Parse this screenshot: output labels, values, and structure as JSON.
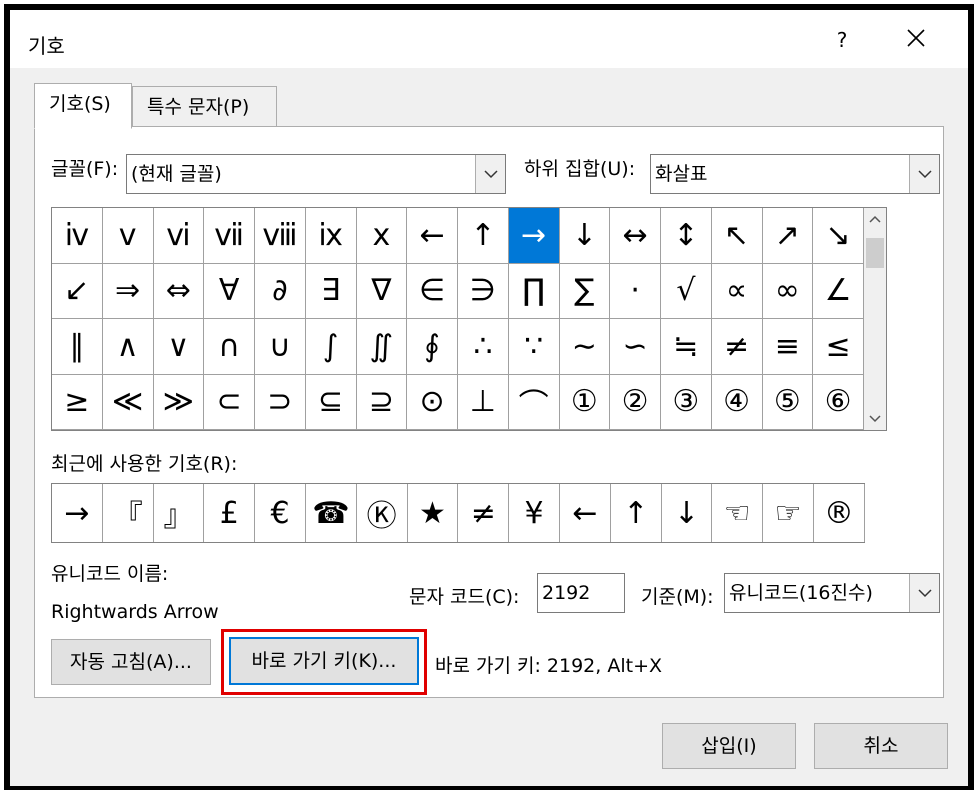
{
  "window": {
    "title": "기호",
    "help_label": "?",
    "close_label": "✕"
  },
  "tabs": [
    {
      "label": "기호(S)",
      "active": true
    },
    {
      "label": "특수 문자(P)",
      "active": false
    }
  ],
  "font": {
    "label": "글꼴(F):",
    "value": "(현재 글꼴)"
  },
  "subset": {
    "label": "하위 집합(U):",
    "value": "화살표"
  },
  "symbols": [
    "ⅳ",
    "ⅴ",
    "ⅵ",
    "ⅶ",
    "ⅷ",
    "ⅸ",
    "ⅹ",
    "←",
    "↑",
    "→",
    "↓",
    "↔",
    "↕",
    "↖",
    "↗",
    "↘",
    "↙",
    "⇒",
    "⇔",
    "∀",
    "∂",
    "∃",
    "∇",
    "∈",
    "∋",
    "∏",
    "∑",
    "·",
    "√",
    "∝",
    "∞",
    "∠",
    "∥",
    "∧",
    "∨",
    "∩",
    "∪",
    "∫",
    "∬",
    "∮",
    "∴",
    "∵",
    "∼",
    "∽",
    "≒",
    "≠",
    "≡",
    "≤",
    "≥",
    "≪",
    "≫",
    "⊂",
    "⊃",
    "⊆",
    "⊇",
    "⊙",
    "⊥",
    "⌒",
    "①",
    "②",
    "③",
    "④",
    "⑤",
    "⑥"
  ],
  "selected_index": 9,
  "recent": {
    "label": "최근에 사용한 기호(R):",
    "items": [
      "→",
      "『",
      "』",
      "£",
      "€",
      "☎",
      "Ⓚ",
      "★",
      "≠",
      "¥",
      "←",
      "↑",
      "↓",
      "☜",
      "☞",
      "®"
    ]
  },
  "unicode_name": {
    "label": "유니코드 이름:",
    "value": "Rightwards Arrow"
  },
  "char_code": {
    "label": "문자 코드(C):",
    "value": "2192"
  },
  "from": {
    "label": "기준(M):",
    "value": "유니코드(16진수)"
  },
  "buttons": {
    "autocorrect": "자동 고침(A)...",
    "shortcut": "바로 가기 키(K)...",
    "insert": "삽입(I)",
    "cancel": "취소"
  },
  "shortcut_info": "바로 가기 키: 2192, Alt+X",
  "colors": {
    "selection": "#0078d7",
    "highlight": "#e00000"
  }
}
